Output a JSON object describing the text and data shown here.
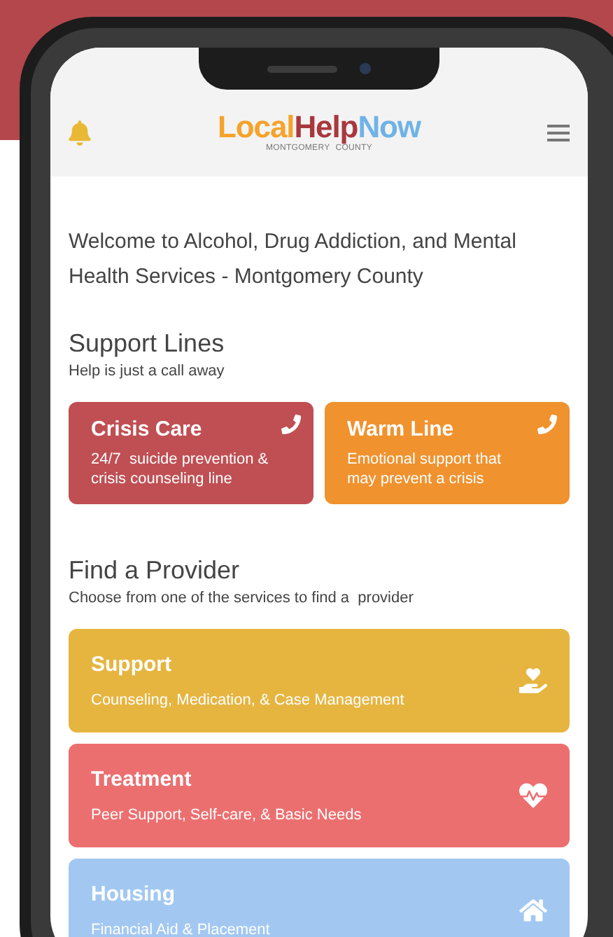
{
  "header": {
    "logo": {
      "parts": [
        {
          "text": "Local",
          "color": "#f5a32b"
        },
        {
          "text": "Help",
          "color": "#a8383e"
        },
        {
          "text": "Now",
          "color": "#6fb3e6"
        }
      ],
      "subtitle": [
        "MONTGOMERY",
        "COUNTY"
      ]
    }
  },
  "welcome": "Welcome to Alcohol, Drug Addiction, and Mental Health Services - Montgomery County",
  "support_lines": {
    "title": "Support Lines",
    "subtitle": "Help is just a call away",
    "cards": [
      {
        "title": "Crisis Care",
        "text": "24/7  suicide prevention & crisis counseling line",
        "color": "#bf4f53"
      },
      {
        "title": "Warm Line",
        "text": "Emotional support that may prevent a crisis",
        "color": "#f0922e"
      }
    ]
  },
  "find_provider": {
    "title": "Find a Provider",
    "subtitle": "Choose from one of the services to find a  provider",
    "services": [
      {
        "kind": "support",
        "title": "Support",
        "text": "Counseling, Medication, & Case Management",
        "color": "#e5b540"
      },
      {
        "kind": "treatment",
        "title": "Treatment",
        "text": "Peer Support, Self-care, & Basic Needs",
        "color": "#ec6f70"
      },
      {
        "kind": "housing",
        "title": "Housing",
        "text": "Financial Aid & Placement",
        "color": "#a2c8f2"
      }
    ]
  }
}
